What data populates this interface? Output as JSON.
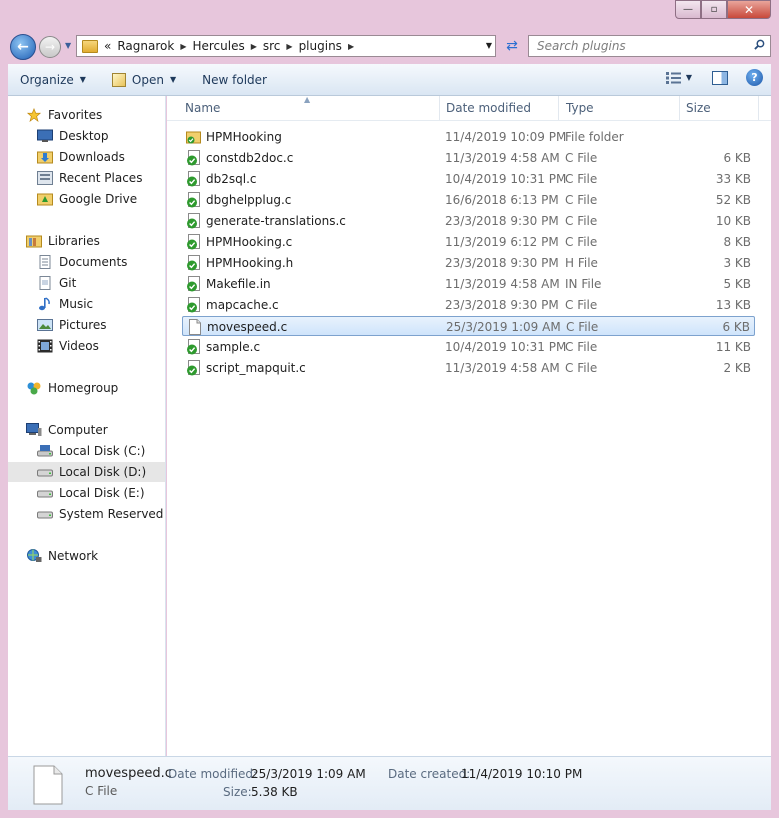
{
  "window": {
    "controls": {
      "minimize": "—",
      "maximize": "▫",
      "close": "✕"
    }
  },
  "navigation": {
    "breadcrumb_prefix": "«",
    "breadcrumbs": [
      "Ragnarok",
      "Hercules",
      "src",
      "plugins"
    ],
    "search_placeholder": "Search plugins"
  },
  "toolbar": {
    "organize": "Organize",
    "open": "Open",
    "new_folder": "New folder"
  },
  "sidebar": {
    "favorites": {
      "label": "Favorites",
      "items": [
        "Desktop",
        "Downloads",
        "Recent Places",
        "Google Drive"
      ]
    },
    "libraries": {
      "label": "Libraries",
      "items": [
        "Documents",
        "Git",
        "Music",
        "Pictures",
        "Videos"
      ]
    },
    "homegroup": "Homegroup",
    "computer": {
      "label": "Computer",
      "items": [
        "Local Disk (C:)",
        "Local Disk (D:)",
        "Local Disk (E:)",
        "System Reserved (H:)"
      ]
    },
    "network": "Network",
    "selected": "Local Disk (D:)"
  },
  "columns": {
    "name": "Name",
    "date": "Date modified",
    "type": "Type",
    "size": "Size"
  },
  "files": [
    {
      "name": "HPMHooking",
      "date": "11/4/2019 10:09 PM",
      "type": "File folder",
      "size": "",
      "icon": "folder-icon"
    },
    {
      "name": "constdb2doc.c",
      "date": "11/3/2019 4:58 AM",
      "type": "C File",
      "size": "6 KB",
      "icon": "synced-file-icon"
    },
    {
      "name": "db2sql.c",
      "date": "10/4/2019 10:31 PM",
      "type": "C File",
      "size": "33 KB",
      "icon": "synced-file-icon"
    },
    {
      "name": "dbghelpplug.c",
      "date": "16/6/2018 6:13 PM",
      "type": "C File",
      "size": "52 KB",
      "icon": "synced-file-icon"
    },
    {
      "name": "generate-translations.c",
      "date": "23/3/2018 9:30 PM",
      "type": "C File",
      "size": "10 KB",
      "icon": "synced-file-icon"
    },
    {
      "name": "HPMHooking.c",
      "date": "11/3/2019 6:12 PM",
      "type": "C File",
      "size": "8 KB",
      "icon": "synced-file-icon"
    },
    {
      "name": "HPMHooking.h",
      "date": "23/3/2018 9:30 PM",
      "type": "H File",
      "size": "3 KB",
      "icon": "synced-file-icon"
    },
    {
      "name": "Makefile.in",
      "date": "11/3/2019 4:58 AM",
      "type": "IN File",
      "size": "5 KB",
      "icon": "synced-file-icon"
    },
    {
      "name": "mapcache.c",
      "date": "23/3/2018 9:30 PM",
      "type": "C File",
      "size": "13 KB",
      "icon": "synced-file-icon"
    },
    {
      "name": "movespeed.c",
      "date": "25/3/2019 1:09 AM",
      "type": "C File",
      "size": "6 KB",
      "icon": "blank-file-icon",
      "selected": true
    },
    {
      "name": "sample.c",
      "date": "10/4/2019 10:31 PM",
      "type": "C File",
      "size": "11 KB",
      "icon": "synced-file-icon"
    },
    {
      "name": "script_mapquit.c",
      "date": "11/3/2019 4:58 AM",
      "type": "C File",
      "size": "2 KB",
      "icon": "synced-file-icon"
    }
  ],
  "details": {
    "name": "movespeed.c",
    "type": "C File",
    "date_modified_label": "Date modified:",
    "date_modified": "25/3/2019 1:09 AM",
    "date_created_label": "Date created:",
    "date_created": "11/4/2019 10:10 PM",
    "size_label": "Size:",
    "size": "5.38 KB"
  },
  "colors": {
    "selection_bg": "#cfe4fb",
    "selection_border": "#7da2ce",
    "frame": "#e7c6dc",
    "sync_green": "#2e9a2e"
  }
}
